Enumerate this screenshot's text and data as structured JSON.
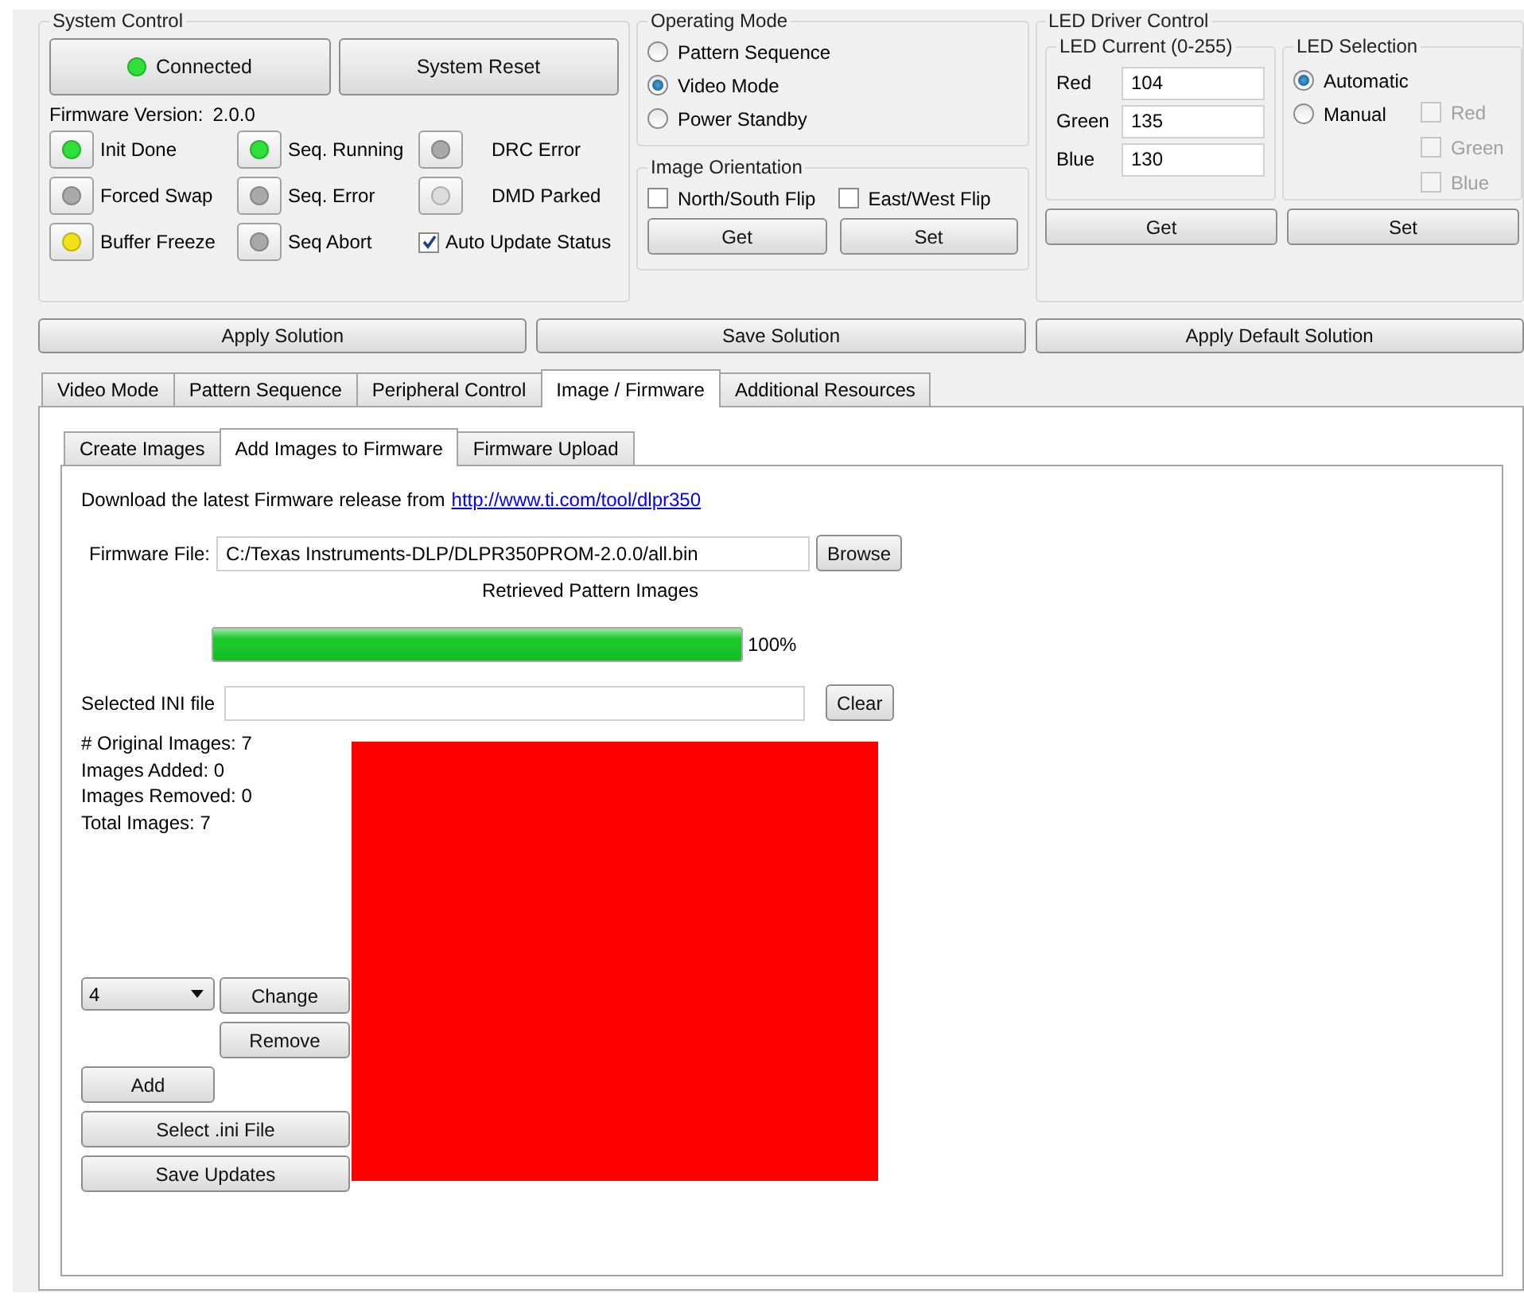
{
  "system_control": {
    "title": "System Control",
    "connect_button": {
      "label": "Connected",
      "color": "#2fe03a"
    },
    "reset_button": "System Reset",
    "firmware_version_label": "Firmware Version:",
    "firmware_version": "2.0.0",
    "indicators": [
      {
        "label": "Init Done",
        "color": "#2fe03a"
      },
      {
        "label": "Seq. Running",
        "color": "#2fe03a"
      },
      {
        "label": "DRC Error",
        "color": "#a9a9a9"
      },
      {
        "label": "Forced Swap",
        "color": "#a9a9a9"
      },
      {
        "label": "Seq. Error",
        "color": "#a9a9a9"
      },
      {
        "label": "DMD Parked",
        "color": "#dcdcdc"
      },
      {
        "label": "Buffer Freeze",
        "color": "#f0e21a"
      },
      {
        "label": "Seq Abort",
        "color": "#a9a9a9"
      }
    ],
    "auto_update": {
      "label": "Auto Update Status",
      "checked": true
    }
  },
  "operating_mode": {
    "title": "Operating Mode",
    "options": [
      {
        "label": "Pattern Sequence",
        "selected": false
      },
      {
        "label": "Video Mode",
        "selected": true
      },
      {
        "label": "Power Standby",
        "selected": false
      }
    ]
  },
  "image_orientation": {
    "title": "Image Orientation",
    "flips": [
      {
        "label": "North/South Flip",
        "checked": false
      },
      {
        "label": "East/West Flip",
        "checked": false
      }
    ],
    "buttons": [
      "Get",
      "Set"
    ]
  },
  "led_driver_control": {
    "title": "LED Driver Control",
    "led_current": {
      "title": "LED Current (0-255)",
      "fields": [
        {
          "label": "Red",
          "value": "104"
        },
        {
          "label": "Green",
          "value": "135"
        },
        {
          "label": "Blue",
          "value": "130"
        }
      ]
    },
    "led_selection": {
      "title": "LED Selection",
      "modes": [
        {
          "label": "Automatic",
          "selected": true
        },
        {
          "label": "Manual",
          "selected": false
        }
      ],
      "colors": [
        {
          "label": "Red",
          "checked": false,
          "disabled": true
        },
        {
          "label": "Green",
          "checked": false,
          "disabled": true
        },
        {
          "label": "Blue",
          "checked": false,
          "disabled": true
        }
      ]
    },
    "buttons": [
      "Get",
      "Set"
    ]
  },
  "solution_buttons": [
    "Apply Solution",
    "Save Solution",
    "Apply Default Solution"
  ],
  "tabs": [
    {
      "label": "Video Mode",
      "selected": false
    },
    {
      "label": "Pattern Sequence",
      "selected": false
    },
    {
      "label": "Peripheral Control",
      "selected": false
    },
    {
      "label": "Image / Firmware",
      "selected": true
    },
    {
      "label": "Additional Resources",
      "selected": false
    }
  ],
  "subtabs": [
    {
      "label": "Create Images",
      "selected": false
    },
    {
      "label": "Add Images to Firmware",
      "selected": true
    },
    {
      "label": "Firmware Upload",
      "selected": false
    }
  ],
  "add_images": {
    "download_text": "Download the latest Firmware release from",
    "download_link": "http://www.ti.com/tool/dlpr350",
    "firmware_file_label": "Firmware File:",
    "firmware_file": "C:/Texas Instruments-DLP/DLPR350PROM-2.0.0/all.bin",
    "browse_button": "Browse",
    "retrieved_label": "Retrieved Pattern Images",
    "progress": {
      "level": 1,
      "reading": "100%"
    },
    "ini_label": "Selected INI file",
    "clear_button": "Clear",
    "stats": [
      "# Original Images: 7",
      "Images Added: 0",
      "Images Removed: 0",
      "Total Images: 7"
    ],
    "image_select": "4",
    "change_button": "Change",
    "remove_button": "Remove",
    "add_button": "Add",
    "select_ini_button": "Select .ini File",
    "save_button": "Save Updates"
  }
}
